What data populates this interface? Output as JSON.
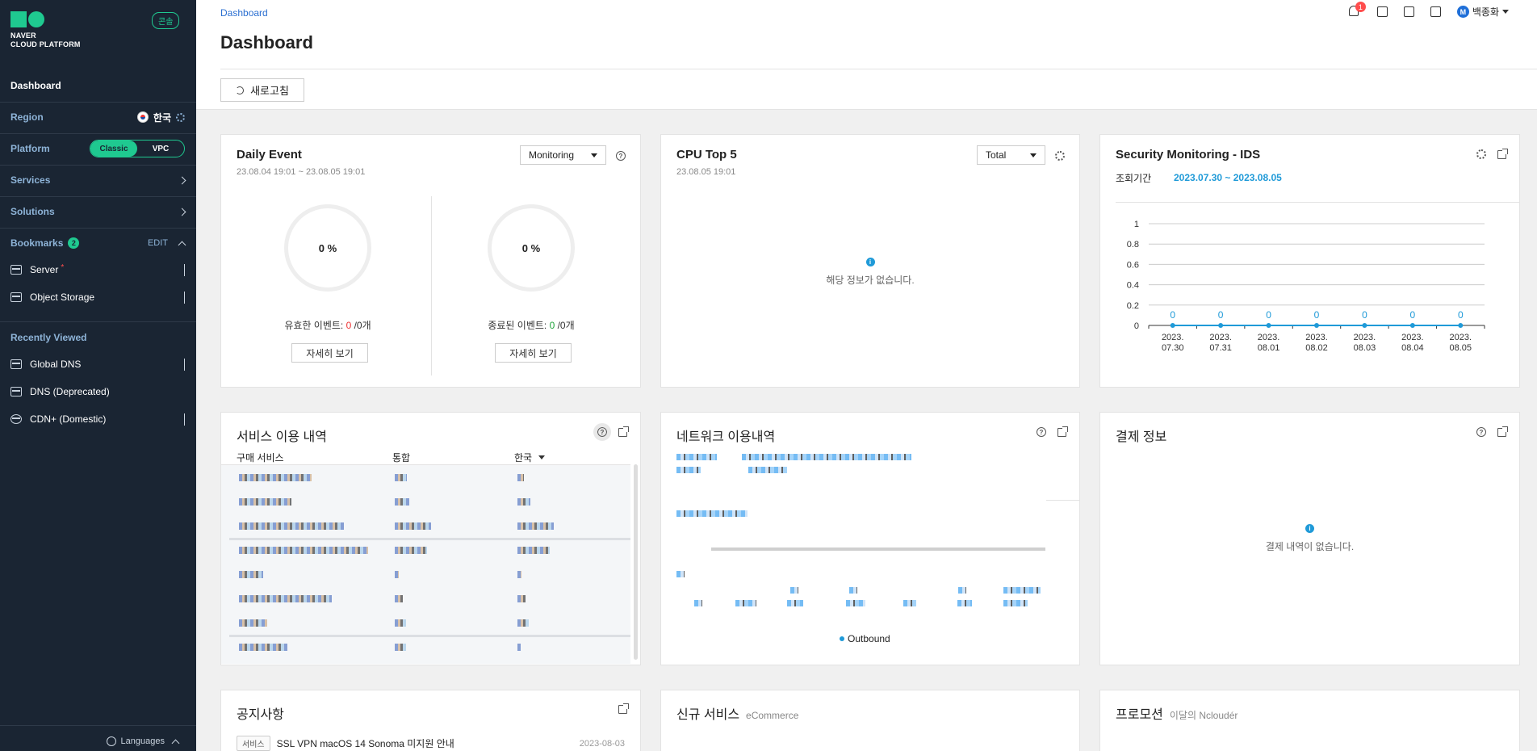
{
  "sidebar": {
    "logo_line1": "NAVER",
    "logo_line2": "CLOUD PLATFORM",
    "console_badge": "콘솔",
    "dashboard": "Dashboard",
    "region_label": "Region",
    "region_value": "한국",
    "platform_label": "Platform",
    "platform_options": [
      "Classic",
      "VPC"
    ],
    "platform_selected": "Classic",
    "services": "Services",
    "solutions": "Solutions",
    "bookmarks_label": "Bookmarks",
    "bookmarks_count": "2",
    "bookmarks_edit": "EDIT",
    "bookmarks": [
      {
        "label": "Server",
        "marker": "*"
      },
      {
        "label": "Object Storage",
        "marker": ""
      }
    ],
    "recently_viewed_label": "Recently Viewed",
    "recent": [
      {
        "label": "Global DNS"
      },
      {
        "label": "DNS (Deprecated)"
      },
      {
        "label": "CDN+ (Domestic)"
      }
    ],
    "languages": "Languages"
  },
  "header": {
    "breadcrumb": "Dashboard",
    "title": "Dashboard",
    "refresh_label": "새로고침",
    "notification_count": "1",
    "user_initial": "M",
    "user_name": "백종화"
  },
  "daily_event": {
    "title": "Daily Event",
    "range": "23.08.04 19:01 ~ 23.08.05 19:01",
    "select_value": "Monitoring",
    "left": {
      "percent": "0 %",
      "label": "유효한 이벤트: ",
      "value": "0",
      "suffix": " /0개",
      "button": "자세히 보기"
    },
    "right": {
      "percent": "0 %",
      "label": "종료된 이벤트: ",
      "value": "0",
      "suffix": " /0개",
      "button": "자세히 보기"
    }
  },
  "cpu_top5": {
    "title": "CPU Top 5",
    "time": "23.08.05 19:01",
    "select_value": "Total",
    "empty_message": "해당 정보가 없습니다."
  },
  "security": {
    "title": "Security Monitoring - IDS",
    "period_label": "조회기간",
    "period_range": "2023.07.30 ~ 2023.08.05"
  },
  "chart_data": {
    "type": "line",
    "categories": [
      "2023.\n07.30",
      "2023.\n07.31",
      "2023.\n08.01",
      "2023.\n08.02",
      "2023.\n08.03",
      "2023.\n08.04",
      "2023.\n08.05"
    ],
    "x_tick_top": [
      "2023.",
      "2023.",
      "2023.",
      "2023.",
      "2023.",
      "2023.",
      "2023."
    ],
    "x_tick_bottom": [
      "07.30",
      "07.31",
      "08.01",
      "08.02",
      "08.03",
      "08.04",
      "08.05"
    ],
    "values": [
      0,
      0,
      0,
      0,
      0,
      0,
      0
    ],
    "data_labels": [
      "0",
      "0",
      "0",
      "0",
      "0",
      "0",
      "0"
    ],
    "y_ticks": [
      "1",
      "0.8",
      "0.6",
      "0.4",
      "0.2",
      "0"
    ],
    "ylim": [
      0,
      1
    ],
    "grid": true,
    "color": "#1f9ad8"
  },
  "service_usage": {
    "title": "서비스 이용 내역",
    "col1": "구매 서비스",
    "col2": "통합",
    "col3": "한국"
  },
  "network_usage": {
    "title": "네트워크 이용내역",
    "legend": "Outbound"
  },
  "billing": {
    "title": "결제 정보",
    "empty_message": "결제 내역이 없습니다."
  },
  "notice": {
    "title": "공지사항",
    "items": [
      {
        "tag": "서비스",
        "text": "SSL VPN macOS 14 Sonoma 미지원 안내",
        "date": "2023-08-03"
      }
    ]
  },
  "new_service": {
    "title": "신규 서비스",
    "subtitle": "eCommerce"
  },
  "promotion": {
    "title": "프로모션",
    "subtitle": "이달의 Ncloudér"
  }
}
